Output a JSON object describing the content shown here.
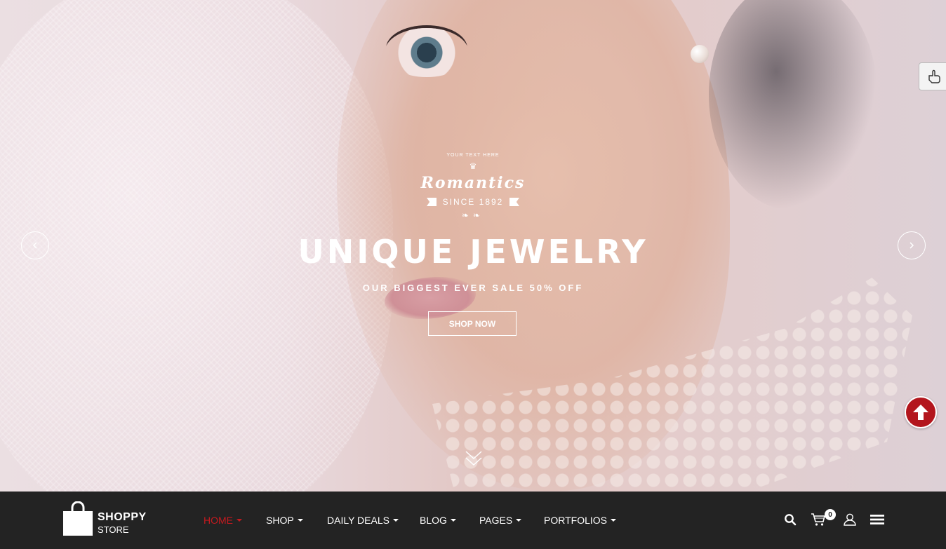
{
  "hero": {
    "badge": {
      "top_text": "YOUR TEXT HERE",
      "script_title": "Romantics",
      "since": "SINCE 1892"
    },
    "headline": "UNIQUE JEWELRY",
    "subline": "OUR BIGGEST EVER SALE 50% OFF",
    "cta_label": "SHOP NOW"
  },
  "nav": {
    "logo": {
      "name": "SHOPPY",
      "sub": "STORE"
    },
    "items": [
      {
        "label": "HOME",
        "active": true
      },
      {
        "label": "SHOP",
        "active": false
      },
      {
        "label": "DAILY DEALS",
        "active": false
      },
      {
        "label": "BLOG",
        "active": false
      },
      {
        "label": "PAGES",
        "active": false
      },
      {
        "label": "PORTFOLIOS",
        "active": false
      }
    ],
    "cart_count": "0"
  },
  "colors": {
    "accent": "#c41a1f",
    "navbar_bg": "#232323",
    "back_to_top": "#b3161d"
  },
  "icons": {
    "prev": "chevron-left-icon",
    "next": "chevron-right-icon",
    "scroll": "double-chevron-down-icon",
    "search": "search-icon",
    "cart": "cart-icon",
    "user": "user-icon",
    "menu": "hamburger-icon",
    "back_to_top": "arrow-up-icon",
    "side_tab": "hand-pointer-icon"
  }
}
